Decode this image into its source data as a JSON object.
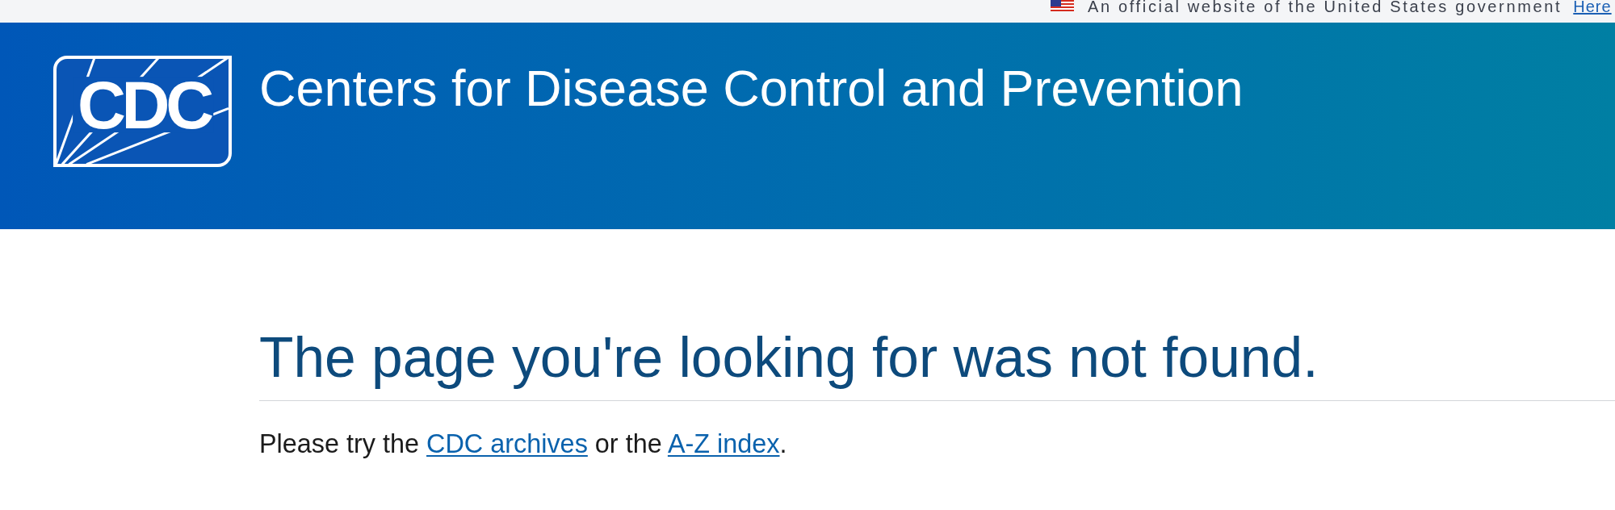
{
  "banner": {
    "text": "An official website of the United States government",
    "link": "Here"
  },
  "header": {
    "logo": "CDC",
    "title": "Centers for Disease Control and Prevention"
  },
  "content": {
    "heading": "The page you're looking for was not found.",
    "message": [
      {
        "kind": "text",
        "text": "Please try the "
      },
      {
        "kind": "link",
        "text": "CDC archives"
      },
      {
        "kind": "text",
        "text": " or the "
      },
      {
        "kind": "link",
        "text": "A-Z index"
      },
      {
        "kind": "text",
        "text": "."
      }
    ]
  }
}
